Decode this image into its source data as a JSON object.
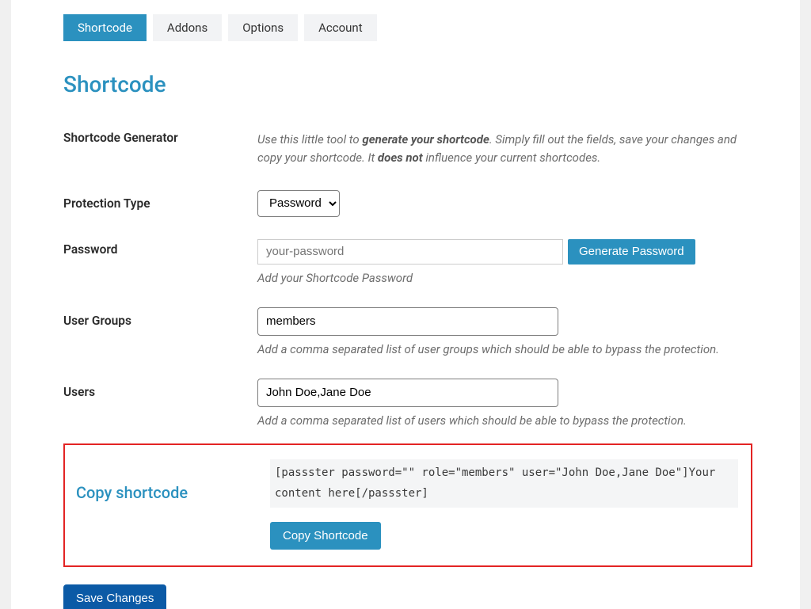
{
  "tabs": {
    "shortcode": "Shortcode",
    "addons": "Addons",
    "options": "Options",
    "account": "Account"
  },
  "page": {
    "title": "Shortcode"
  },
  "generator": {
    "label": "Shortcode Generator",
    "intro_pre": "Use this little tool to ",
    "intro_bold1": "generate your shortcode",
    "intro_mid": ". Simply fill out the fields, save your changes and copy your shortcode. It ",
    "intro_bold2": "does not",
    "intro_post": " influence your current shortcodes."
  },
  "protection": {
    "label": "Protection Type",
    "selected": "Password"
  },
  "password": {
    "label": "Password",
    "placeholder": "your-password",
    "generate_btn": "Generate Password",
    "desc": "Add your Shortcode Password"
  },
  "groups": {
    "label": "User Groups",
    "value": "members",
    "desc": "Add a comma separated list of user groups which should be able to bypass the protection."
  },
  "users": {
    "label": "Users",
    "value": "John Doe,Jane Doe",
    "desc": "Add a comma separated list of users which should be able to bypass the protection."
  },
  "copy": {
    "label": "Copy shortcode",
    "code": " [passster password=\"\" role=\"members\" user=\"John Doe,Jane Doe\"]Your content here[/passster]",
    "btn": "Copy Shortcode"
  },
  "save": {
    "btn": "Save Changes"
  }
}
